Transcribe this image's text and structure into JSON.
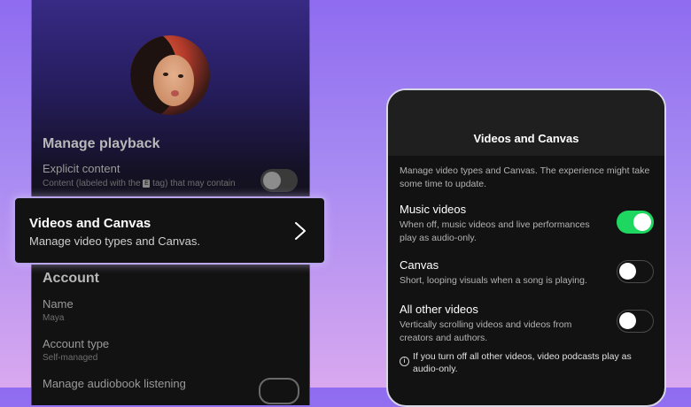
{
  "left_panel": {
    "manage_playback_title": "Manage playback",
    "explicit_content_title": "Explicit content",
    "explicit_content_sub_before": "Content (labeled with the ",
    "explicit_tag_glyph": "E",
    "explicit_content_sub_after": " tag) that may contain",
    "account_title": "Account",
    "name_label": "Name",
    "name_value": "Maya",
    "account_type_label": "Account type",
    "account_type_value": "Self-managed",
    "audiobook_label": "Manage audiobook listening"
  },
  "highlight_card": {
    "title": "Videos and Canvas",
    "subtitle": "Manage video types and Canvas.",
    "chevron_icon": "chevron-right-icon"
  },
  "right_panel": {
    "title": "Videos and Canvas",
    "description": "Manage video types and Canvas. The experience might take some time to update.",
    "options": [
      {
        "title": "Music videos",
        "subtitle": "When off, music videos and live performances play as audio-only.",
        "enabled": true
      },
      {
        "title": "Canvas",
        "subtitle": "Short, looping visuals when a song is playing.",
        "enabled": false
      },
      {
        "title": "All other videos",
        "subtitle": "Vertically scrolling videos and videos from creators and authors.",
        "enabled": false
      }
    ],
    "info_icon": "info-icon",
    "info_note": "If you turn off all other videos, video podcasts play as audio-only."
  },
  "colors": {
    "accent_green": "#1ed760",
    "background_purple": "#8f6cf0",
    "panel_dark": "#121212"
  }
}
